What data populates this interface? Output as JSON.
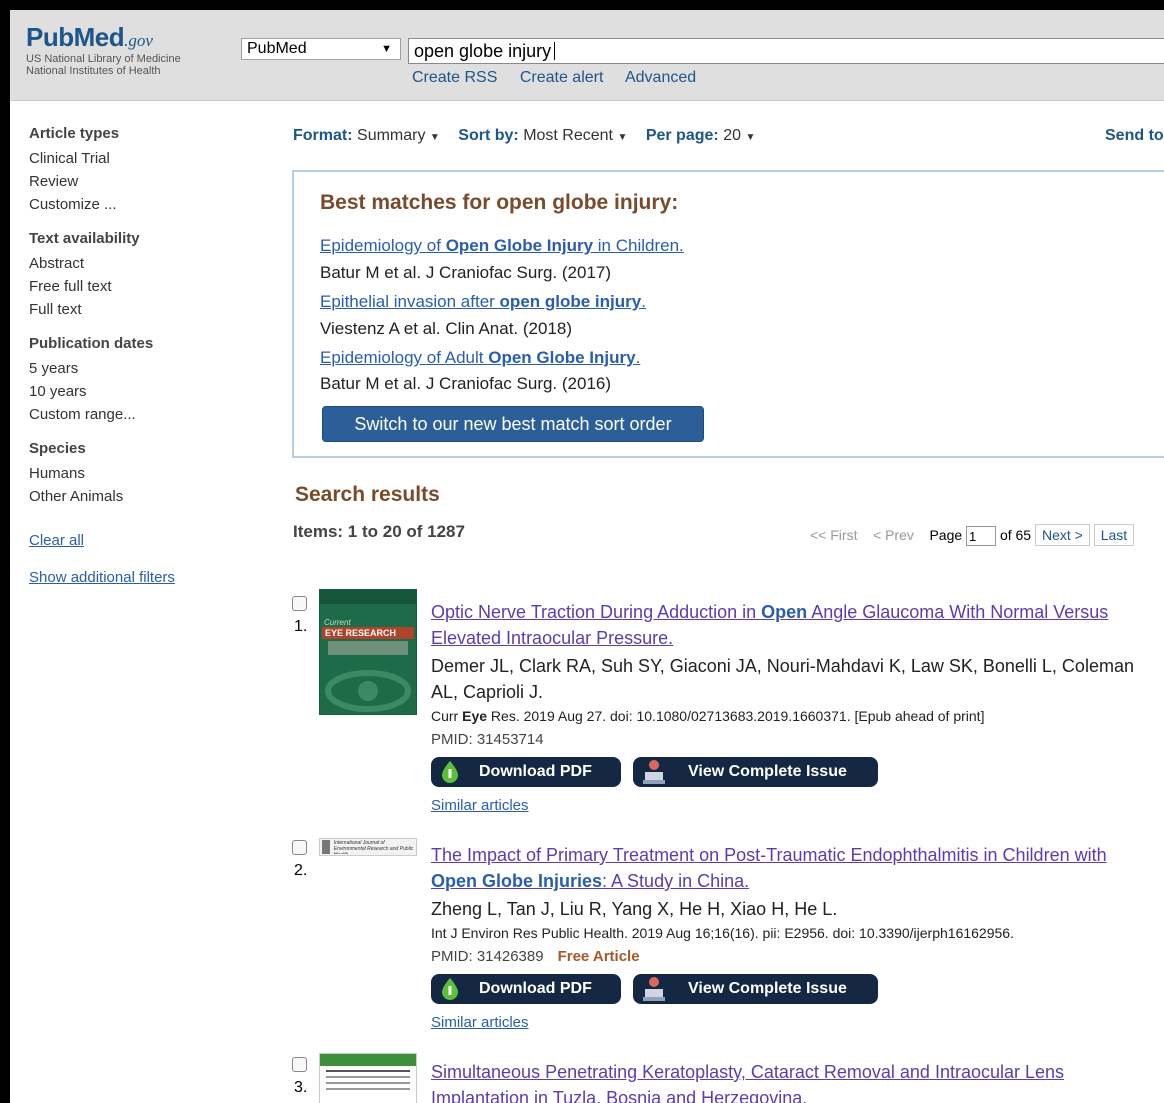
{
  "header": {
    "logo_brand": "PubMed",
    "logo_gov": ".gov",
    "logo_sub1": "US National Library of Medicine",
    "logo_sub2": "National Institutes of Health",
    "db_select": "PubMed",
    "search_query": "open globe injury",
    "links": [
      "Create RSS",
      "Create alert",
      "Advanced"
    ]
  },
  "sidebar": {
    "groups": [
      {
        "title": "Article types",
        "items": [
          "Clinical Trial",
          "Review",
          "Customize ..."
        ]
      },
      {
        "title": "Text availability",
        "items": [
          "Abstract",
          "Free full text",
          "Full text"
        ]
      },
      {
        "title": "Publication dates",
        "items": [
          "5 years",
          "10 years",
          "Custom range..."
        ]
      },
      {
        "title": "Species",
        "items": [
          "Humans",
          "Other Animals"
        ]
      }
    ],
    "clear_all": "Clear all",
    "show_filters": "Show additional filters"
  },
  "toolbar": {
    "format_label": "Format:",
    "format_value": "Summary",
    "sort_label": "Sort by:",
    "sort_value": "Most Recent",
    "perpage_label": "Per page:",
    "perpage_value": "20",
    "send_to": "Send to"
  },
  "best_matches": {
    "heading": "Best matches for open globe injury:",
    "items": [
      {
        "title_pre": "Epidemiology of ",
        "title_bold": "Open Globe Injury",
        "title_post": " in Children.",
        "cite": "Batur M et al. J Craniofac Surg. (2017)"
      },
      {
        "title_pre": "Epithelial invasion after ",
        "title_bold": "open globe injury",
        "title_post": ".",
        "cite": "Viestenz A et al. Clin Anat. (2018)"
      },
      {
        "title_pre": "Epidemiology of Adult ",
        "title_bold": "Open Globe Injury",
        "title_post": ".",
        "cite": "Batur M et al. J Craniofac Surg. (2016)"
      }
    ],
    "switch_button": "Switch to our new best match sort order"
  },
  "results": {
    "heading": "Search results",
    "items_count": "Items: 1 to 20 of 1287",
    "pager": {
      "first": "<< First",
      "prev": "< Prev",
      "page_label": "Page",
      "page_value": "1",
      "of": "of 65",
      "next": "Next >",
      "last": "Last"
    },
    "list": [
      {
        "num": "1.",
        "title_l1_pre": "Optic Nerve Traction During Adduction in ",
        "title_l1_bold": "Open",
        "title_l1_post": " Angle Glaucoma With Normal Versus",
        "title_l2": "Elevated Intraocular Pressure.",
        "authors_l1": "Demer JL, Clark RA, Suh SY, Giaconi JA, Nouri-Mahdavi K, Law SK, Bonelli L, Coleman",
        "authors_l2": "AL, Caprioli J.",
        "cite_pre": "Curr ",
        "cite_bold": "Eye",
        "cite_post": " Res. 2019 Aug 27. doi: 10.1080/02713683.2019.1660371. [Epub ahead of print]",
        "pmid": "PMID: 31453714",
        "free": "",
        "thumb_title": "Current",
        "thumb_journal": "EYE RESEARCH"
      },
      {
        "num": "2.",
        "title_l1_pre": "The Impact of Primary Treatment on Post-Traumatic Endophthalmitis in Children with",
        "title_l1_bold": "",
        "title_l1_post": "",
        "title_l2_bold": "Open Globe Injuries",
        "title_l2": ": A Study in China.",
        "authors_l1": "Zheng L, Tan J, Liu R, Yang X, He H, Xiao H, He L.",
        "cite_full": "Int J Environ Res Public Health. 2019 Aug 16;16(16). pii: E2956. doi: 10.3390/ijerph16162956.",
        "pmid": "PMID: 31426389",
        "free": "Free Article",
        "thumb_title": "International Journal of Environmental Research and Public Health"
      },
      {
        "num": "3.",
        "title_l1": "Simultaneous Penetrating Keratoplasty, Cataract Removal and Intraocular Lens",
        "title_l2": "Implantation in Tuzla, Bosnia and Herzegovina."
      }
    ],
    "download_pdf": "Download PDF",
    "view_issue": "View Complete Issue",
    "similar": "Similar articles"
  },
  "colors": {
    "brand": "#20558a",
    "link": "#2a5db0",
    "visited": "#5a3db0",
    "heading": "#7a4a2c",
    "pill": "#142844",
    "free": "#a3592a"
  }
}
